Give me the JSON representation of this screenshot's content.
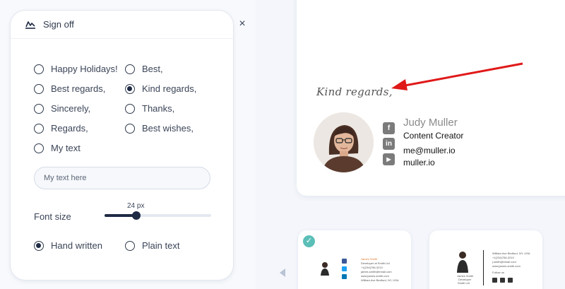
{
  "panel": {
    "title": "Sign off",
    "close_symbol": "×",
    "options": [
      {
        "label": "Happy Holidays!",
        "checked": false
      },
      {
        "label": "Best,",
        "checked": false
      },
      {
        "label": "Best regards,",
        "checked": false
      },
      {
        "label": "Kind regards,",
        "checked": true
      },
      {
        "label": "Sincerely,",
        "checked": false
      },
      {
        "label": "Thanks,",
        "checked": false
      },
      {
        "label": "Regards,",
        "checked": false
      },
      {
        "label": "Best wishes,",
        "checked": false
      },
      {
        "label": "My text",
        "checked": false
      }
    ],
    "my_text_placeholder": "My text here",
    "font_size": {
      "label": "Font size",
      "value_text": "24 px",
      "fraction": 0.3
    },
    "style_options": [
      {
        "label": "Hand written",
        "checked": true
      },
      {
        "label": "Plain text",
        "checked": false
      }
    ]
  },
  "preview": {
    "signoff": "Kind regards,",
    "name": "Judy Muller",
    "role": "Content Creator",
    "email": "me@muller.io",
    "website": "muller.io",
    "socials": [
      {
        "icon": "facebook-icon",
        "glyph": "f"
      },
      {
        "icon": "linkedin-icon",
        "glyph": "in"
      },
      {
        "icon": "youtube-icon",
        "glyph": "▶"
      }
    ],
    "arrow_color": "#e01919"
  },
  "templates": {
    "selected_index": 0,
    "check_glyph": "✓",
    "t1": {
      "name": "James Smith",
      "lines": [
        "Developer at Smith Ltd",
        "+1(234)756-3210",
        "james.smith@email.com",
        "www.james-smith.com",
        "William Ave Bedford, NY, USA"
      ]
    },
    "t2": {
      "lines": [
        "William Ave Bedford, NY, USA",
        "+1(234)756-3210",
        "j.smith@email.com",
        "www.james-smith.com"
      ],
      "follow": "Follow us",
      "caption": [
        "James Smith",
        "Developer",
        "Smith Ltd"
      ]
    }
  },
  "colors": {
    "accent": "#1f2a44",
    "check": "#5bbfb8",
    "muted": "#7b7b7b"
  }
}
